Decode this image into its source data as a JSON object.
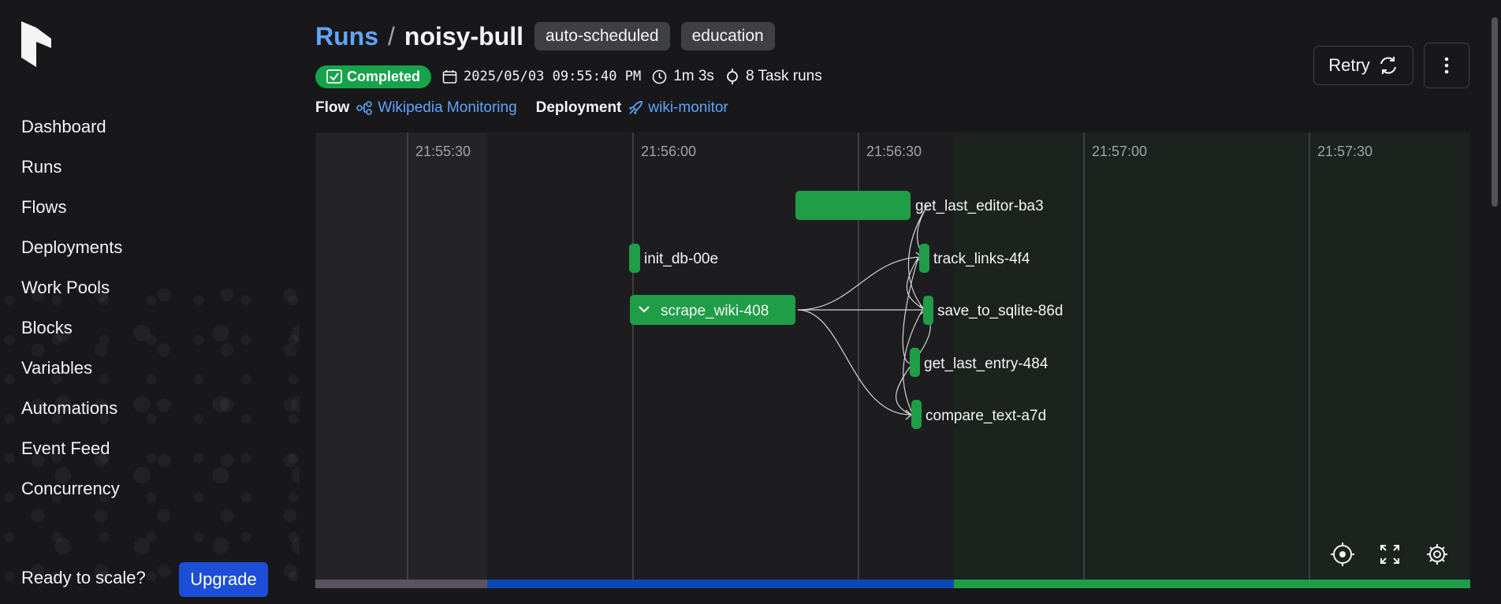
{
  "sidebar": {
    "logo": "prefect-logo-icon",
    "nav": [
      "Dashboard",
      "Runs",
      "Flows",
      "Deployments",
      "Work Pools",
      "Blocks",
      "Variables",
      "Automations",
      "Event Feed",
      "Concurrency"
    ],
    "ready_text": "Ready to scale?",
    "upgrade_label": "Upgrade"
  },
  "header": {
    "breadcrumb_root": "Runs",
    "breadcrumb_sep": "/",
    "run_name": "noisy-bull",
    "tags": [
      "auto-scheduled",
      "education"
    ],
    "state": "Completed",
    "start_time": "2025/05/03 09:55:40 PM",
    "duration": "1m 3s",
    "task_runs": "8 Task runs",
    "flow_label": "Flow",
    "flow_name": "Wikipedia Monitoring",
    "deployment_label": "Deployment",
    "deployment_name": "wiki-monitor",
    "retry_label": "Retry"
  },
  "timeline": {
    "ticks": [
      "21:55:30",
      "21:56:00",
      "21:56:30",
      "21:57:00",
      "21:57:30"
    ],
    "nodes": [
      {
        "id": "get_last_editor",
        "label": "get_last_editor-ba3",
        "kind": "task"
      },
      {
        "id": "init_db",
        "label": "init_db-00e",
        "kind": "task"
      },
      {
        "id": "scrape_wiki",
        "label": "scrape_wiki-408",
        "kind": "subflow"
      },
      {
        "id": "track_links",
        "label": "track_links-4f4",
        "kind": "task"
      },
      {
        "id": "save_to_sqlite",
        "label": "save_to_sqlite-86d",
        "kind": "task"
      },
      {
        "id": "get_last_entry",
        "label": "get_last_entry-484",
        "kind": "task"
      },
      {
        "id": "compare_text",
        "label": "compare_text-a7d",
        "kind": "task"
      }
    ],
    "controls": [
      "recenter-icon",
      "fullscreen-icon",
      "settings-icon"
    ],
    "colors": {
      "completed": "#1f9d47",
      "scheduled": "#5b5262",
      "running": "#0b49b3",
      "bg": "#202024"
    }
  }
}
